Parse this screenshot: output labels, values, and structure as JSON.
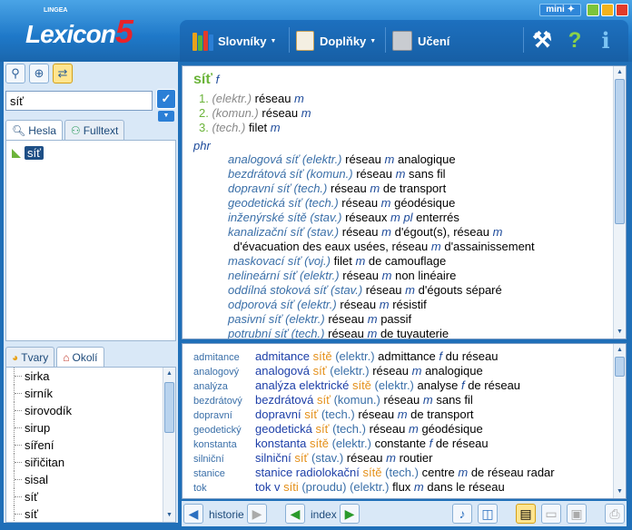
{
  "app": {
    "brand_small": "LINGEA",
    "brand": "Lexicon",
    "brand_num": "5",
    "mini_label": "mini"
  },
  "toolbar": {
    "menu1": "Slovníky",
    "menu2": "Doplňky",
    "menu3": "Učení"
  },
  "search": {
    "value": "síť"
  },
  "tabs": {
    "hesla": "Hesla",
    "fulltext": "Fulltext",
    "tvary": "Tvary",
    "okoli": "Okolí"
  },
  "wordlist": {
    "selected": "síť"
  },
  "neighborhood": [
    "sirka",
    "sirník",
    "sirovodík",
    "sirup",
    "síření",
    "siřičitan",
    "sisal",
    "síť",
    "síť"
  ],
  "entry": {
    "headword": "síť",
    "gender": "f",
    "senses": [
      {
        "num": "1.",
        "label": "(elektr.)",
        "tr": "réseau",
        "g": "m"
      },
      {
        "num": "2.",
        "label": "(komun.)",
        "tr": "réseau",
        "g": "m"
      },
      {
        "num": "3.",
        "label": "(tech.)",
        "tr": "filet",
        "g": "m"
      }
    ],
    "phr_label": "phr",
    "phrases": [
      {
        "src": "analogová síť (elektr.)",
        "t1": "réseau",
        "g1": "m",
        "t2": "analogique"
      },
      {
        "src": "bezdrátová síť (komun.)",
        "t1": "réseau",
        "g1": "m",
        "t2": "sans fil"
      },
      {
        "src": "dopravní síť (tech.)",
        "t1": "réseau",
        "g1": "m",
        "t2": "de transport"
      },
      {
        "src": "geodetická síť (tech.)",
        "t1": "réseau",
        "g1": "m",
        "t2": "géodésique"
      },
      {
        "src": "inženýrské sítě (stav.)",
        "t1": "réseaux",
        "g1": "m pl",
        "t2": "enterrés"
      },
      {
        "src": "kanalizační síť (stav.)",
        "t1": "réseau",
        "g1": "m",
        "t2": "d'égout(s), réseau",
        "g2": "m"
      },
      {
        "cont": true,
        "t1": "d'évacuation des eaux usées, réseau",
        "g1": "m",
        "t2": "d'assainissement"
      },
      {
        "src": "maskovací síť (voj.)",
        "t1": "filet",
        "g1": "m",
        "t2": "de camouflage"
      },
      {
        "src": "nelineární síť (elektr.)",
        "t1": "réseau",
        "g1": "m",
        "t2": "non linéaire"
      },
      {
        "src": "oddílná stoková síť (stav.)",
        "t1": "réseau",
        "g1": "m",
        "t2": "d'égouts séparé"
      },
      {
        "src": "odporová síť (elektr.)",
        "t1": "réseau",
        "g1": "m",
        "t2": "résistif"
      },
      {
        "src": "pasivní síť (elektr.)",
        "t1": "réseau",
        "g1": "m",
        "t2": "passif"
      },
      {
        "src": "potrubní síť (tech.)",
        "t1": "réseau",
        "g1": "m",
        "t2": "de tuyauterie"
      }
    ]
  },
  "fulltext": [
    {
      "key": "admitance",
      "head": "admitance",
      "hl": "sítě",
      "lab": "(elektr.)",
      "t1": "admittance",
      "g1": "f",
      "t2": "du réseau"
    },
    {
      "key": "analogový",
      "head": "analogová",
      "hl": "síť",
      "lab": "(elektr.)",
      "t1": "réseau",
      "g1": "m",
      "t2": "analogique"
    },
    {
      "key": "analýza",
      "head": "analýza elektrické",
      "hl": "sítě",
      "lab": "(elektr.)",
      "t1": "analyse",
      "g1": "f",
      "t2": "de réseau"
    },
    {
      "key": "bezdrátový",
      "head": "bezdrátová",
      "hl": "síť",
      "lab": "(komun.)",
      "t1": "réseau",
      "g1": "m",
      "t2": "sans fil"
    },
    {
      "key": "dopravní",
      "head": "dopravní",
      "hl": "síť",
      "lab": "(tech.)",
      "t1": "réseau",
      "g1": "m",
      "t2": "de transport"
    },
    {
      "key": "geodetický",
      "head": "geodetická",
      "hl": "síť",
      "lab": "(tech.)",
      "t1": "réseau",
      "g1": "m",
      "t2": "géodésique"
    },
    {
      "key": "konstanta",
      "head": "konstanta",
      "hl": "sítě",
      "lab": "(elektr.)",
      "t1": "constante",
      "g1": "f",
      "t2": "de réseau"
    },
    {
      "key": "silniční",
      "head": "silniční",
      "hl": "síť",
      "lab": "(stav.)",
      "t1": "réseau",
      "g1": "m",
      "t2": "routier"
    },
    {
      "key": "stanice",
      "head": "stanice radiolokační",
      "hl": "sítě",
      "lab": "(tech.)",
      "t1": "centre",
      "g1": "m",
      "t2": "de réseau radar"
    },
    {
      "key": "tok",
      "head": "tok v",
      "hl": "síti",
      "lab": "(proudu) (elektr.)",
      "t1": "flux",
      "g1": "m",
      "t2": "dans le réseau"
    }
  ],
  "bottombar": {
    "historie": "historie",
    "index": "index"
  }
}
